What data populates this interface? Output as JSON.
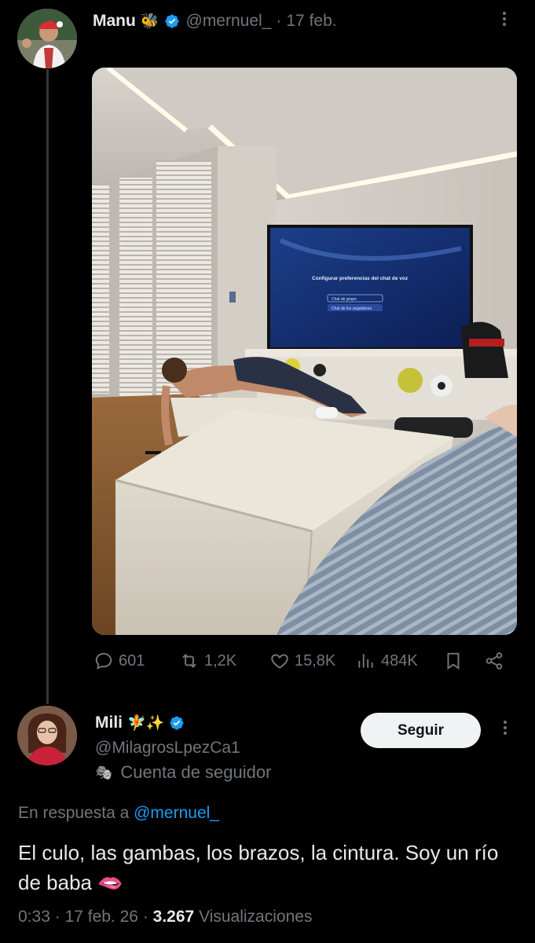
{
  "tweet": {
    "author_name": "Manu",
    "author_emoji": "🐝",
    "handle": "@mernuel_",
    "separator": "·",
    "date": "17 feb.",
    "metrics": {
      "replies": "601",
      "retweets": "1,2K",
      "likes": "15,8K",
      "views": "484K"
    },
    "tv_screen": {
      "title": "Configurar preferencias del chat de voz",
      "option_1": "Chat de grupo",
      "option_2": "Chat de los seguidores"
    }
  },
  "reply": {
    "author_name": "Mili",
    "author_emoji": "🧚✨",
    "handle": "@MilagrosLpezCa1",
    "account_label": "Cuenta de seguidor",
    "account_icon": "🎭",
    "follow_label": "Seguir",
    "in_reply_prefix": "En respuesta a",
    "in_reply_handle": "@mernuel_",
    "text": "El culo, las gambas, los brazos, la cintura. Soy un río de baba 🫦",
    "time": "0:33",
    "separator": "·",
    "date": "17 feb. 26",
    "views_count": "3.267",
    "views_label": "Visualizaciones"
  },
  "colors": {
    "background": "#000000",
    "text": "#e7e9ea",
    "muted": "#71767b",
    "link": "#1d9bf0",
    "verified": "#1d9bf0",
    "button_bg": "#eff3f4"
  }
}
